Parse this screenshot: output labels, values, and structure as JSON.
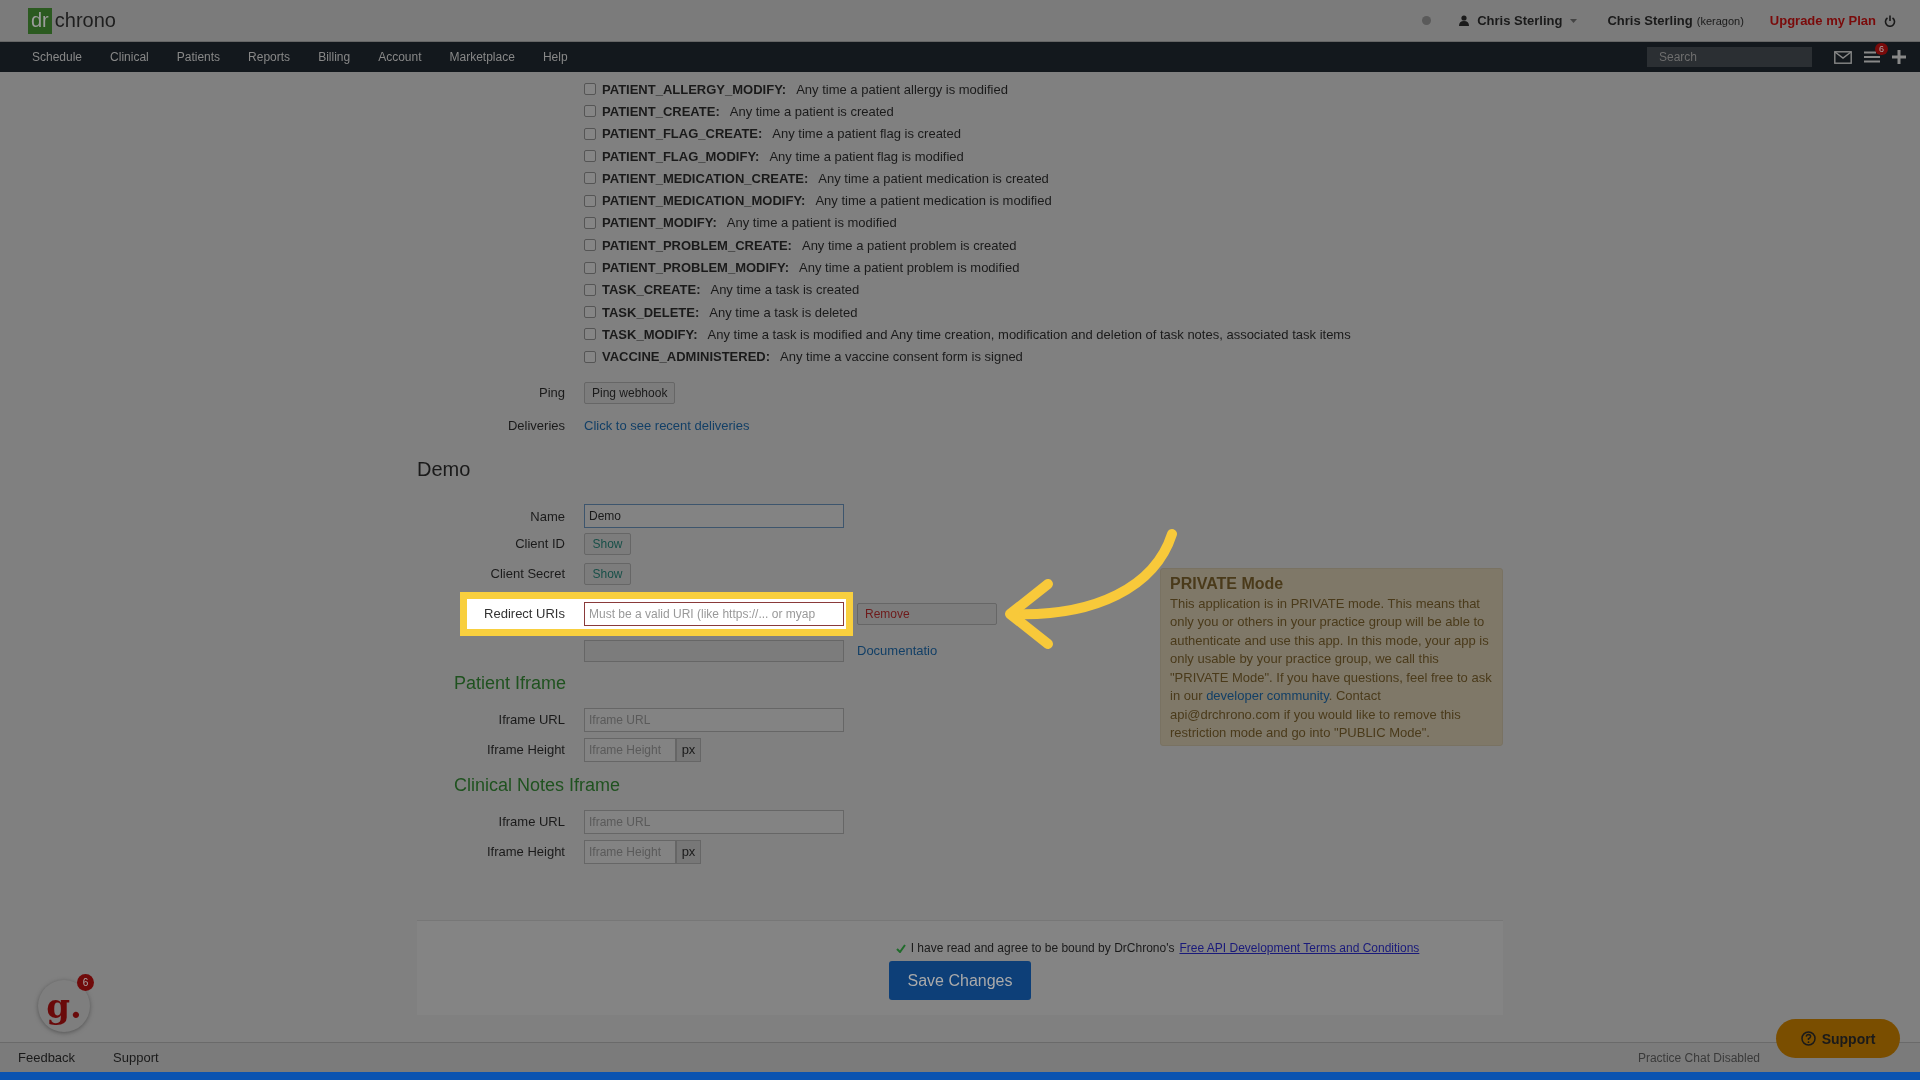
{
  "header": {
    "logo_dr": "dr",
    "logo_chrono": "chrono",
    "user_menu": "Chris Sterling",
    "account": "Chris Sterling",
    "account_note": "(keragon)",
    "upgrade_link": "Upgrade my Plan"
  },
  "nav": {
    "items": [
      "Schedule",
      "Clinical",
      "Patients",
      "Reports",
      "Billing",
      "Account",
      "Marketplace",
      "Help"
    ],
    "search": {
      "placeholder": "Search"
    },
    "notification_count": "6"
  },
  "webhook_events": [
    {
      "name": "PATIENT_ALLERGY_MODIFY:",
      "description": "Any time a patient allergy is modified",
      "checked": false
    },
    {
      "name": "PATIENT_CREATE:",
      "description": "Any time a patient is created",
      "checked": false
    },
    {
      "name": "PATIENT_FLAG_CREATE:",
      "description": "Any time a patient flag is created",
      "checked": false
    },
    {
      "name": "PATIENT_FLAG_MODIFY:",
      "description": "Any time a patient flag is modified",
      "checked": false
    },
    {
      "name": "PATIENT_MEDICATION_CREATE:",
      "description": "Any time a patient medication is created",
      "checked": false
    },
    {
      "name": "PATIENT_MEDICATION_MODIFY:",
      "description": "Any time a patient medication is modified",
      "checked": false
    },
    {
      "name": "PATIENT_MODIFY:",
      "description": "Any time a patient is modified",
      "checked": false
    },
    {
      "name": "PATIENT_PROBLEM_CREATE:",
      "description": "Any time a patient problem is created",
      "checked": false
    },
    {
      "name": "PATIENT_PROBLEM_MODIFY:",
      "description": "Any time a patient problem is modified",
      "checked": false
    },
    {
      "name": "TASK_CREATE:",
      "description": "Any time a task is created",
      "checked": false
    },
    {
      "name": "TASK_DELETE:",
      "description": "Any time a task is deleted",
      "checked": false
    },
    {
      "name": "TASK_MODIFY:",
      "description": "Any time a task is modified and Any time creation, modification and deletion of task notes, associated task items",
      "checked": false
    },
    {
      "name": "VACCINE_ADMINISTERED:",
      "description": "Any time a vaccine consent form is signed",
      "checked": false
    }
  ],
  "ping": {
    "label": "Ping",
    "button": "Ping webhook"
  },
  "deliveries": {
    "label": "Deliveries",
    "link": "Click to see recent deliveries"
  },
  "app": {
    "title": "Demo",
    "name": {
      "label": "Name",
      "value": "Demo"
    },
    "client_id": {
      "label": "Client ID",
      "button": "Show"
    },
    "client_secret": {
      "label": "Client Secret",
      "button": "Show"
    },
    "redirect_uris": {
      "label": "Redirect URIs",
      "placeholder": "Must be a valid URI (like https://... or myap",
      "remove": "Remove",
      "highlighted": true
    },
    "documentation_link": "Documentatio"
  },
  "iframes": [
    {
      "title": "Patient Iframe",
      "url": {
        "label": "Iframe URL",
        "placeholder": "Iframe URL"
      },
      "height": {
        "label": "Iframe Height",
        "placeholder": "Iframe Height",
        "unit": "px"
      }
    },
    {
      "title": "Clinical Notes Iframe",
      "url": {
        "label": "Iframe URL",
        "placeholder": "Iframe URL"
      },
      "height": {
        "label": "Iframe Height",
        "placeholder": "Iframe Height",
        "unit": "px"
      }
    }
  ],
  "private_notice": {
    "title": "PRIVATE Mode",
    "text_before": "This application is in PRIVATE mode. This means that only you or others in your practice group will be able to authenticate and use this app. In this mode, your app is only usable by your practice group, we call this \"PRIVATE Mode\". If you have questions, feel free to ask in our",
    "link": "developer community",
    "text_after": ". Contact api@drchrono.com if you would like to remove this restriction mode and go into \"PUBLIC Mode\"."
  },
  "footer": {
    "agreed": true,
    "agreement": "I have read and agree to be bound by DrChrono's",
    "terms_link": "Free API Development Terms and Conditions",
    "save_button": "Save Changes"
  },
  "bottom_bar": {
    "links": [
      "Feedback",
      "Support"
    ],
    "chat_status": "Practice Chat Disabled",
    "support_button": "Support",
    "assistant_logo": "g.",
    "assistant_badge": "6"
  }
}
